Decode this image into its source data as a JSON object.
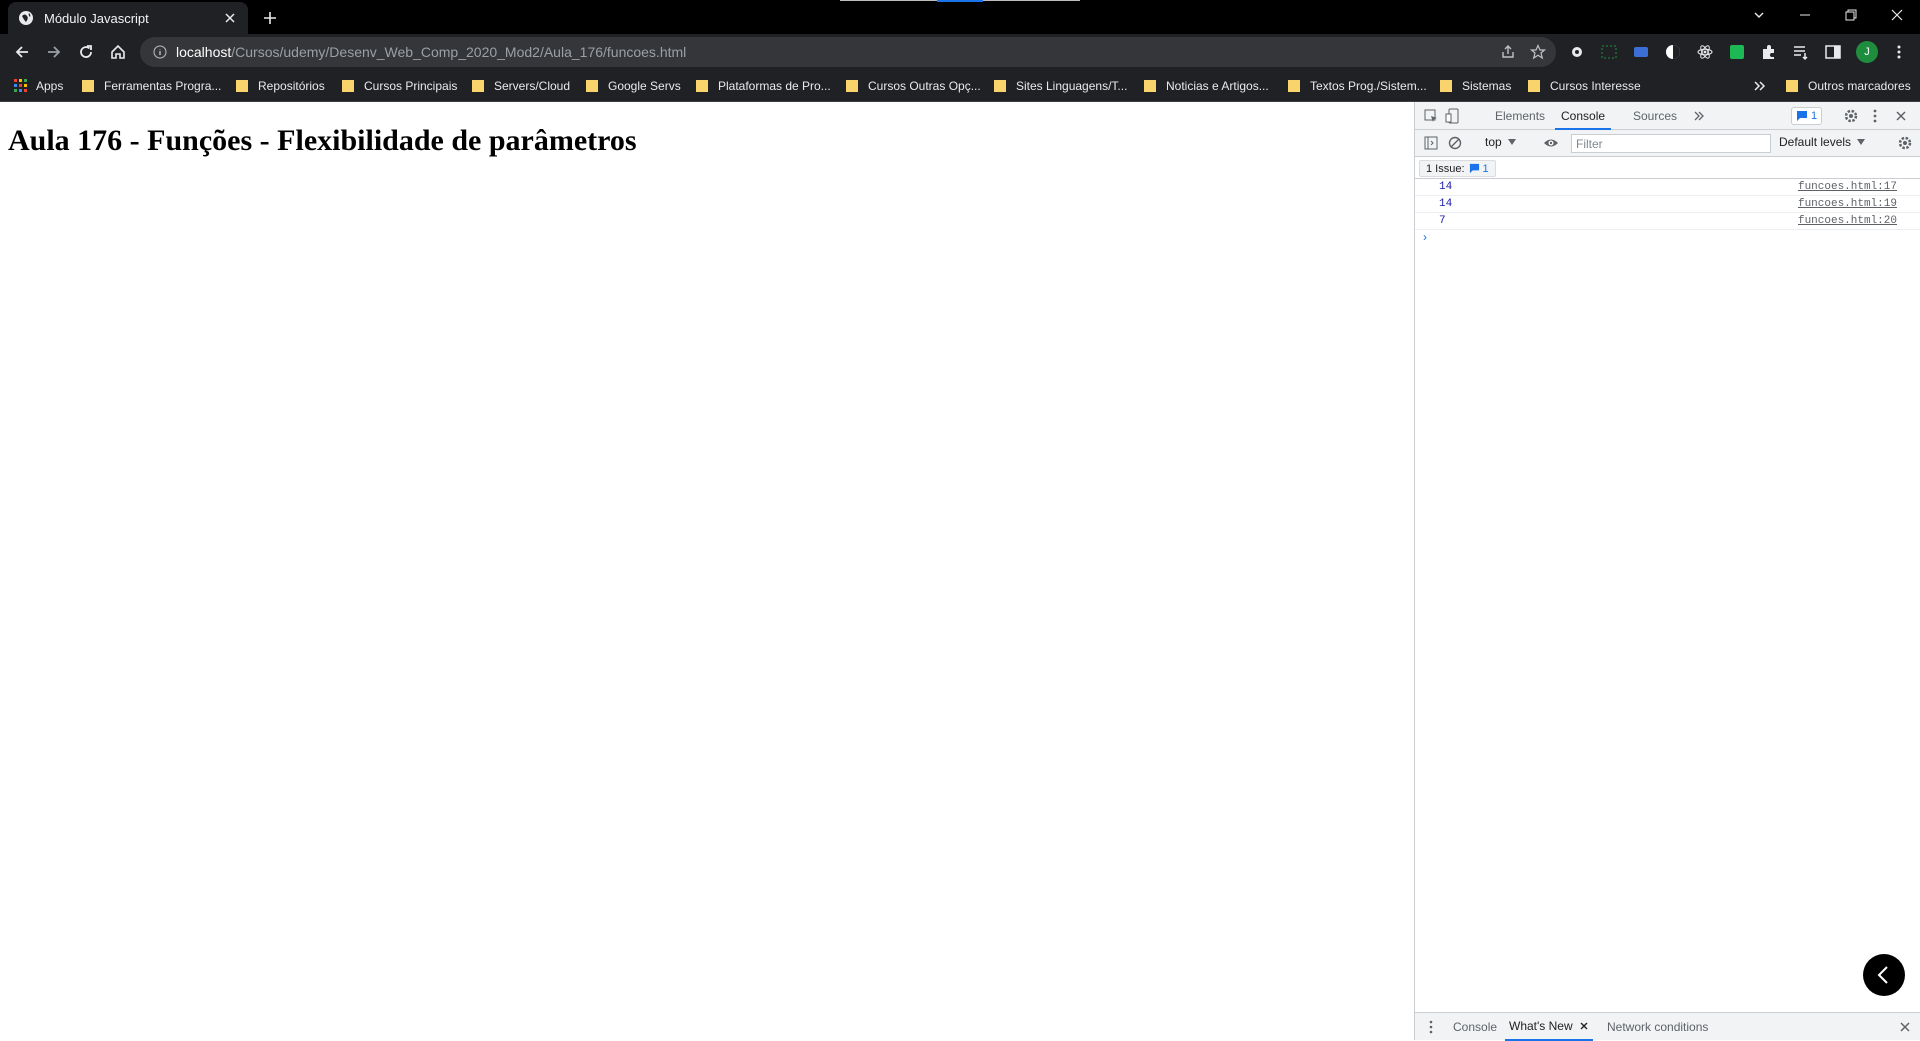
{
  "browser": {
    "tab": {
      "title": "Módulo Javascript"
    },
    "address": {
      "host": "localhost",
      "path": "/Cursos/udemy/Desenv_Web_Comp_2020_Mod2/Aula_176/funcoes.html"
    },
    "profile_initial": "J",
    "bookmarks": [
      {
        "label": "Apps",
        "type": "apps"
      },
      {
        "label": "Ferramentas Progra...",
        "type": "folder"
      },
      {
        "label": "Repositórios",
        "type": "folder"
      },
      {
        "label": "Cursos Principais",
        "type": "folder"
      },
      {
        "label": "Servers/Cloud",
        "type": "folder"
      },
      {
        "label": "Google Servs",
        "type": "folder"
      },
      {
        "label": "Plataformas de Pro...",
        "type": "folder"
      },
      {
        "label": "Cursos Outras Opç...",
        "type": "folder"
      },
      {
        "label": "Sites Linguagens/T...",
        "type": "folder"
      },
      {
        "label": "Noticias e Artigos...",
        "type": "folder"
      },
      {
        "label": "Textos Prog./Sistem...",
        "type": "folder"
      },
      {
        "label": "Sistemas",
        "type": "folder"
      },
      {
        "label": "Cursos Interesse",
        "type": "folder"
      }
    ],
    "other_bookmarks": "Outros marcadores"
  },
  "page": {
    "heading": "Aula 176 - Funções - Flexibilidade de parâmetros"
  },
  "devtools": {
    "tabs": [
      "Elements",
      "Console",
      "Sources"
    ],
    "active_tab": "Console",
    "issues_badge": "1",
    "context": "top",
    "filter_placeholder": "Filter",
    "levels": "Default levels",
    "issues_label": "1 Issue:",
    "issues_count": "1",
    "messages": [
      {
        "value": "14",
        "source": "funcoes.html:17"
      },
      {
        "value": "14",
        "source": "funcoes.html:19"
      },
      {
        "value": "7",
        "source": "funcoes.html:20"
      }
    ],
    "prompt": "›",
    "drawer_tabs": [
      "Console",
      "What's New",
      "Network conditions"
    ],
    "drawer_active": "What's New"
  },
  "colors": {
    "chrome_dark": "#202124",
    "accent": "#1a73e8",
    "folder": "#f9d36b"
  }
}
